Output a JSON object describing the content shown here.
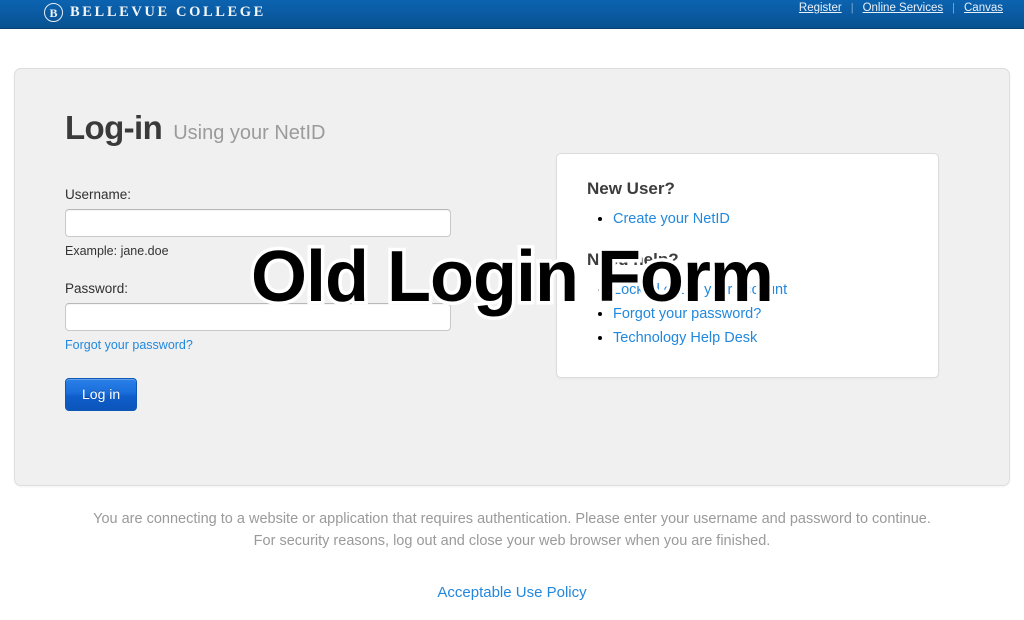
{
  "topbar": {
    "brand_mark": "B",
    "brand_name": "BELLEVUE COLLEGE",
    "separator": "|",
    "nav": [
      {
        "label": "Register"
      },
      {
        "label": "Online Services"
      },
      {
        "label": "Canvas"
      }
    ]
  },
  "login": {
    "heading_main": "Log-in",
    "heading_sub": "Using your NetID",
    "username_label": "Username:",
    "username_value": "",
    "username_placeholder": "",
    "username_hint": "Example: jane.doe",
    "password_label": "Password:",
    "password_value": "",
    "password_placeholder": "",
    "forgot_password_label": "Forgot your password?",
    "submit_label": "Log in"
  },
  "help_panel": {
    "new_user_heading": "New User?",
    "new_user_links": [
      {
        "label": "Create your NetID"
      }
    ],
    "need_help_heading": "Need help?",
    "need_help_links": [
      {
        "label": "Locked out of your account"
      },
      {
        "label": "Forgot your password?"
      },
      {
        "label": "Technology Help Desk"
      }
    ]
  },
  "overlay": {
    "text": "Old Login Form"
  },
  "footer": {
    "line1": "You are connecting to a website or application that requires authentication. Please enter your username and password to continue.",
    "line2": "For security reasons, log out and close your web browser when you are finished.",
    "policy_label": "Acceptable Use Policy"
  },
  "colors": {
    "header_blue": "#0a5aa2",
    "link_blue": "#2288dd",
    "button_blue": "#1a6edb",
    "card_gray": "#f0f0f0"
  }
}
